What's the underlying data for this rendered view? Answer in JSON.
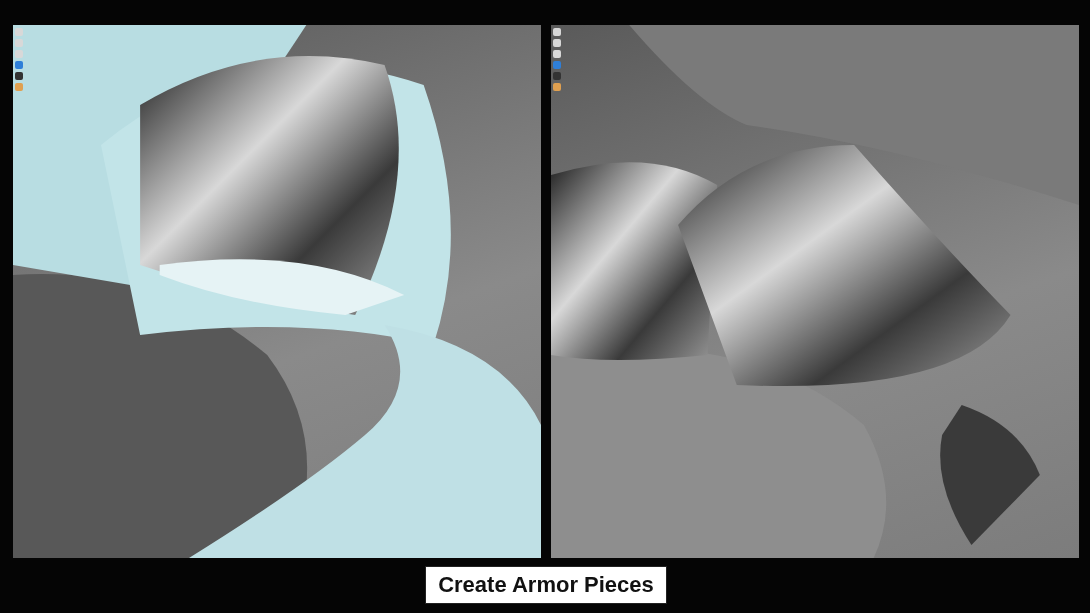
{
  "viewports": [
    {
      "kind": "pattern"
    },
    {
      "kind": "metal"
    }
  ],
  "caption": "Create Armor Pieces"
}
